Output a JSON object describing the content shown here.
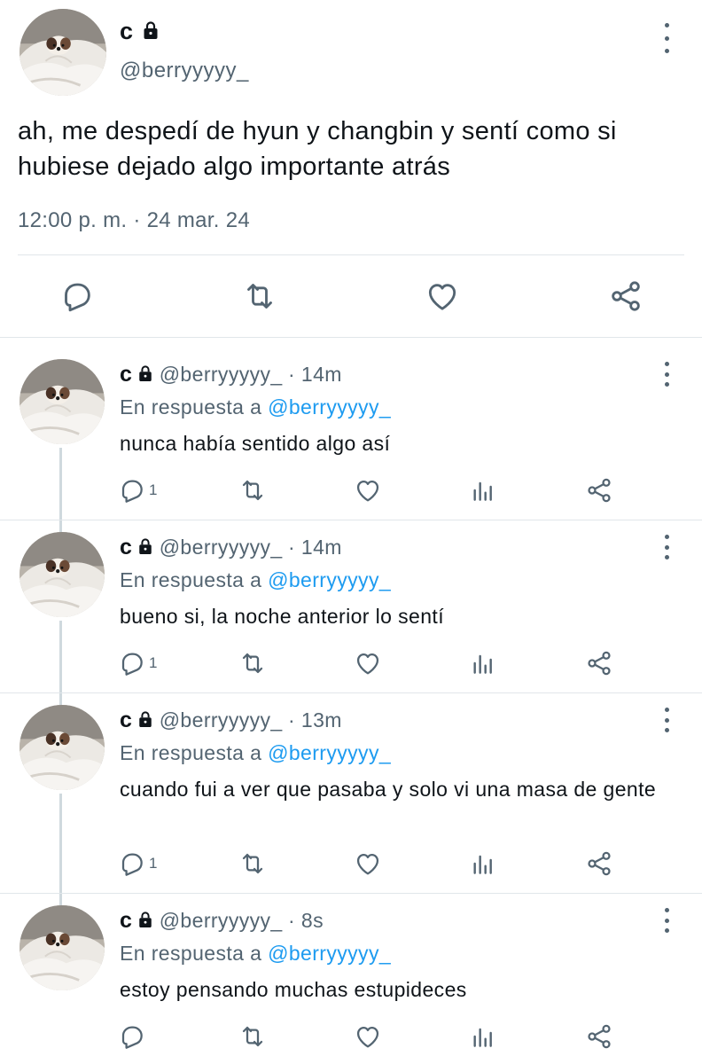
{
  "main_tweet": {
    "display_name": "c",
    "handle": "@berryyyyy_",
    "text": "ah, me despedí de hyun y changbin y sentí como si hubiese dejado algo importante atrás",
    "time": "12:00 p. m.",
    "separator": "·",
    "date": "24 mar. 24",
    "icons": [
      "reply-icon",
      "retweet-icon",
      "like-icon",
      "share-icon",
      "more-icon",
      "lock-icon"
    ]
  },
  "replies": [
    {
      "display_name": "c",
      "handle": "@berryyyyy_",
      "age": "· 14m",
      "reply_prefix": "En respuesta a",
      "reply_to": "@berryyyyy_",
      "text": "nunca había sentido algo así",
      "reply_count": "1"
    },
    {
      "display_name": "c",
      "handle": "@berryyyyy_",
      "age": "· 14m",
      "reply_prefix": "En respuesta a",
      "reply_to": "@berryyyyy_",
      "text": "bueno si, la noche anterior lo sentí",
      "reply_count": "1"
    },
    {
      "display_name": "c",
      "handle": "@berryyyyy_",
      "age": "· 13m",
      "reply_prefix": "En respuesta a",
      "reply_to": "@berryyyyy_",
      "text": "cuando fui a ver que pasaba y solo vi una masa de gente",
      "reply_count": "1"
    },
    {
      "display_name": "c",
      "handle": "@berryyyyy_",
      "age": "· 8s",
      "reply_prefix": "En respuesta a",
      "reply_to": "@berryyyyy_",
      "text": "estoy pensando muchas estupideces",
      "reply_count": ""
    }
  ],
  "colors": {
    "text": "#0f1419",
    "muted": "#536471",
    "link": "#1d9bf0",
    "divider": "#e1e6ea",
    "thread_line": "#cfd9de"
  }
}
